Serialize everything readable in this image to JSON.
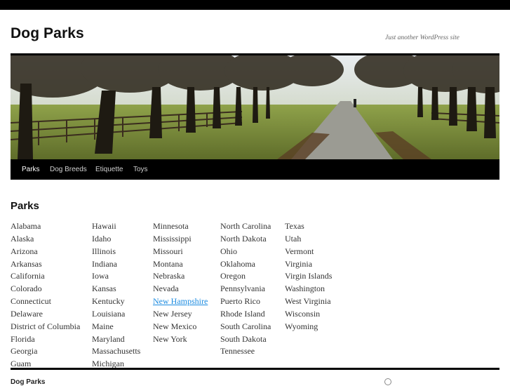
{
  "site": {
    "title": "Dog Parks",
    "description": "Just another WordPress site"
  },
  "nav": {
    "items": [
      {
        "label": "Parks",
        "active": true
      },
      {
        "label": "Dog Breeds",
        "active": false
      },
      {
        "label": "Etiquette",
        "active": false
      },
      {
        "label": "Toys",
        "active": false
      }
    ]
  },
  "page": {
    "heading": "Parks",
    "hovered_link": "New Hampshire",
    "hover_color": "#1b8be0",
    "columns": [
      [
        "Alabama",
        "Alaska",
        "Arizona",
        "Arkansas",
        "California",
        "Colorado",
        "Connecticut",
        "Delaware",
        "District of Columbia",
        "Florida",
        "Georgia",
        "Guam"
      ],
      [
        "Hawaii",
        "Idaho",
        "Illinois",
        "Indiana",
        "Iowa",
        "Kansas",
        "Kentucky",
        "Louisiana",
        "Maine",
        "Maryland",
        "Massachusetts",
        "Michigan"
      ],
      [
        "Minnesota",
        "Mississippi",
        "Missouri",
        "Montana",
        "Nebraska",
        "Nevada",
        "New Hampshire",
        "New Jersey",
        "New Mexico",
        "New York"
      ],
      [
        "North Carolina",
        "North Dakota",
        "Ohio",
        "Oklahoma",
        "Oregon",
        "Pennsylvania",
        "Puerto Rico",
        "Rhode Island",
        "South Carolina",
        "South Dakota",
        "Tennessee"
      ],
      [
        "Texas",
        "Utah",
        "Vermont",
        "Virginia",
        "Virgin Islands",
        "Washington",
        "West Virginia",
        "Wisconsin",
        "Wyoming"
      ]
    ]
  },
  "footer": {
    "site_title": "Dog Parks",
    "icon": "wordpress-icon"
  }
}
